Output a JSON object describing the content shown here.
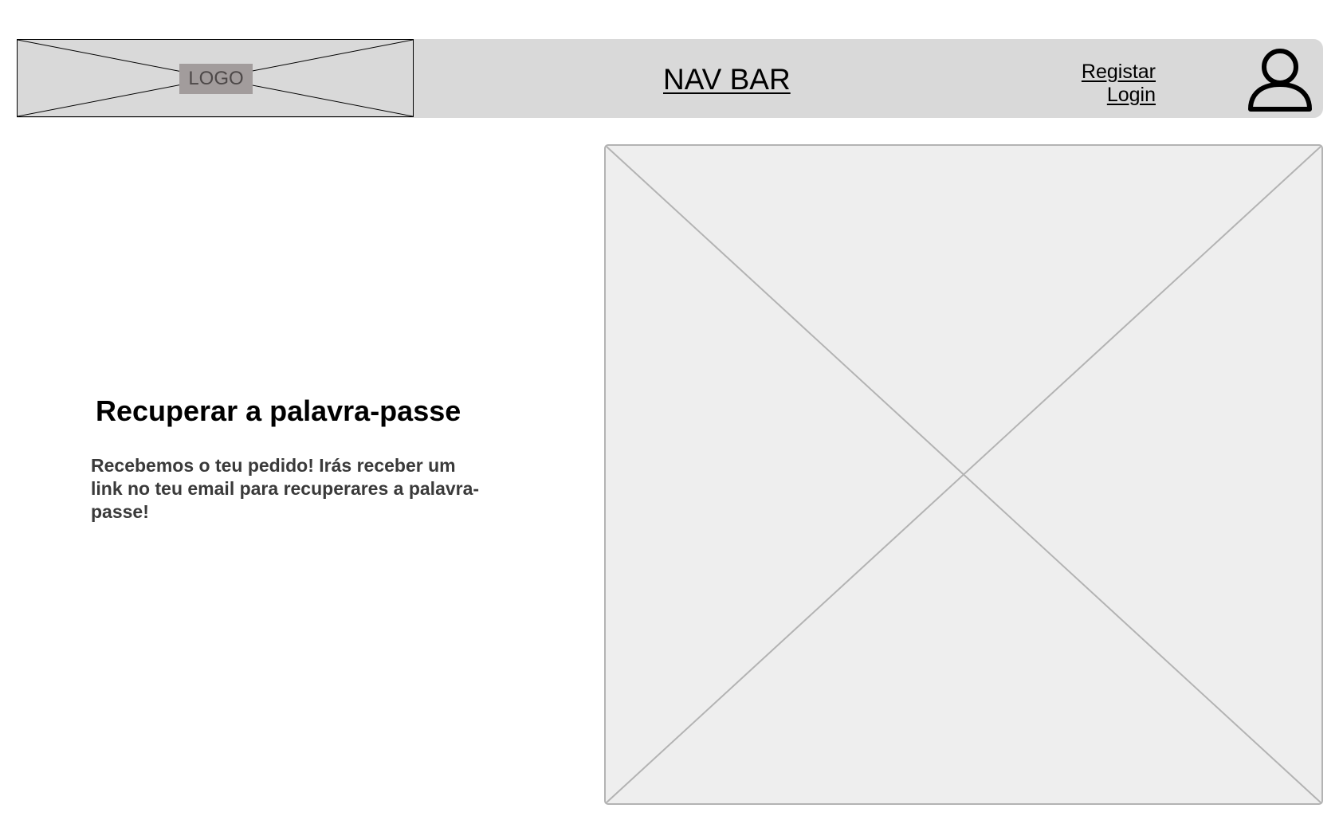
{
  "navbar": {
    "logo_label": "LOGO",
    "title": "NAV BAR",
    "register_label": "Registar",
    "login_label": "Login",
    "user_icon": "user-icon"
  },
  "main": {
    "heading": "Recuperar a palavra-passe",
    "message": "Recebemos o teu pedido! Irás receber um link no teu email para recuperares a palavra-passe!",
    "image_placeholder": "image-placeholder"
  },
  "colors": {
    "navbar_background": "#d9d9d9",
    "logo_label_background": "#a29c9c",
    "image_placeholder_background": "#eeeeee",
    "image_placeholder_border": "#b3b3b3",
    "message_text": "#3a3a3a"
  }
}
